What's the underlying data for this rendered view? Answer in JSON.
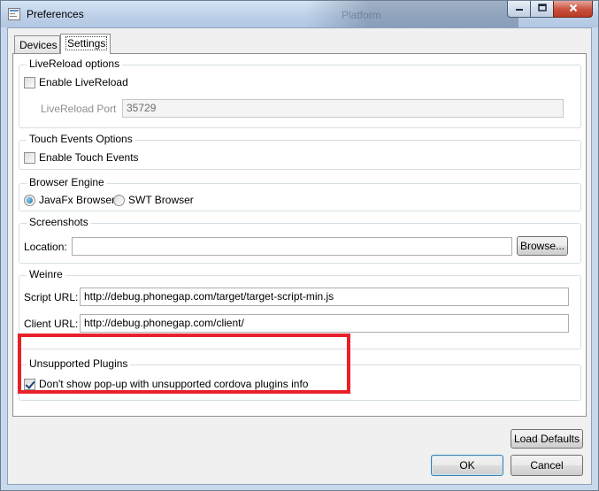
{
  "window": {
    "title": "Preferences",
    "background_title": "Platform",
    "icons": {
      "app": "preferences-app-icon",
      "minimize": "minimize-icon",
      "maximize": "maximize-icon",
      "close": "close-icon"
    }
  },
  "tabs": [
    {
      "label": "Devices",
      "selected": false
    },
    {
      "label": "Settings",
      "selected": true
    }
  ],
  "settings": {
    "livereload": {
      "title": "LiveReload options",
      "enable_label": "Enable LiveReload",
      "enable_checked": false,
      "port_label": "LiveReload Port",
      "port_value": "35729",
      "port_enabled": false
    },
    "touch_events": {
      "title": "Touch Events Options",
      "enable_label": "Enable Touch Events",
      "enable_checked": false
    },
    "browser_engine": {
      "title": "Browser Engine",
      "options": [
        {
          "label": "JavaFx Browser",
          "selected": true
        },
        {
          "label": "SWT Browser",
          "selected": false
        }
      ]
    },
    "screenshots": {
      "title": "Screenshots",
      "location_label": "Location:",
      "location_value": "",
      "browse_label": "Browse..."
    },
    "weinre": {
      "title": "Weinre",
      "script_url_label": "Script URL:",
      "script_url_value": "http://debug.phonegap.com/target/target-script-min.js",
      "client_url_label": "Client URL:",
      "client_url_value": "http://debug.phonegap.com/client/"
    },
    "unsupported_plugins": {
      "title": "Unsupported Plugins",
      "dont_show_label": "Don't show pop-up with unsupported cordova plugins info",
      "dont_show_checked": true
    }
  },
  "footer": {
    "load_defaults_label": "Load Defaults",
    "ok_label": "OK",
    "cancel_label": "Cancel"
  },
  "colors": {
    "highlight": "#e8202a",
    "title_bar": "#bdd0e8",
    "close_button": "#c8503c"
  }
}
